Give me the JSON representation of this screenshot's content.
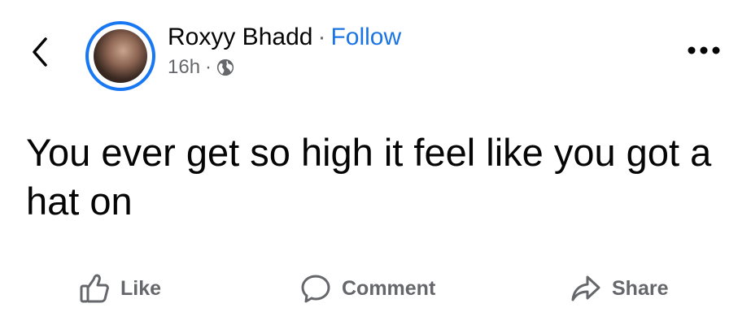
{
  "post": {
    "author_name": "Roxyy Bhadd",
    "separator": "·",
    "follow_label": "Follow",
    "timestamp": "16h",
    "meta_separator": "·",
    "privacy_icon": "globe-icon",
    "text": "You ever get so high it feel like you got a hat on"
  },
  "header": {
    "back_icon": "chevron-left-icon",
    "more_icon": "more-horizontal-icon"
  },
  "actions": {
    "like_label": "Like",
    "comment_label": "Comment",
    "share_label": "Share"
  },
  "colors": {
    "accent": "#1877f2",
    "link": "#1b74e4",
    "secondary_text": "#65676b",
    "primary_text": "#050505"
  }
}
